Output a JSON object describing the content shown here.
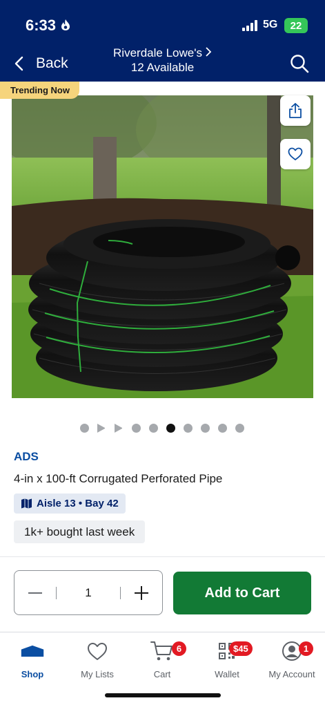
{
  "status_bar": {
    "time": "6:33",
    "network": "5G",
    "battery": "22"
  },
  "header": {
    "back_label": "Back",
    "store_name": "Riverdale Lowe's",
    "availability": "12 Available",
    "brand_color": "#012169"
  },
  "product": {
    "trending_badge": "Trending Now",
    "brand": "ADS",
    "title": "4-in x 100-ft Corrugated Perforated Pipe",
    "aisle": "Aisle 13 • Bay 42",
    "social_proof": "1k+ bought last week",
    "image_dot_count": 10,
    "active_image_index": 5
  },
  "purchase": {
    "quantity": "1",
    "add_to_cart_label": "Add to Cart",
    "button_color": "#127a35"
  },
  "bottom_nav": {
    "items": [
      {
        "label": "Shop",
        "icon": "shop-icon",
        "active": true
      },
      {
        "label": "My Lists",
        "icon": "heart-icon",
        "active": false
      },
      {
        "label": "Cart",
        "icon": "cart-icon",
        "badge": "6",
        "active": false
      },
      {
        "label": "Wallet",
        "icon": "qr-code-icon",
        "badge": "$45",
        "active": false
      },
      {
        "label": "My Account",
        "icon": "account-icon",
        "badge": "1",
        "active": false
      }
    ]
  }
}
